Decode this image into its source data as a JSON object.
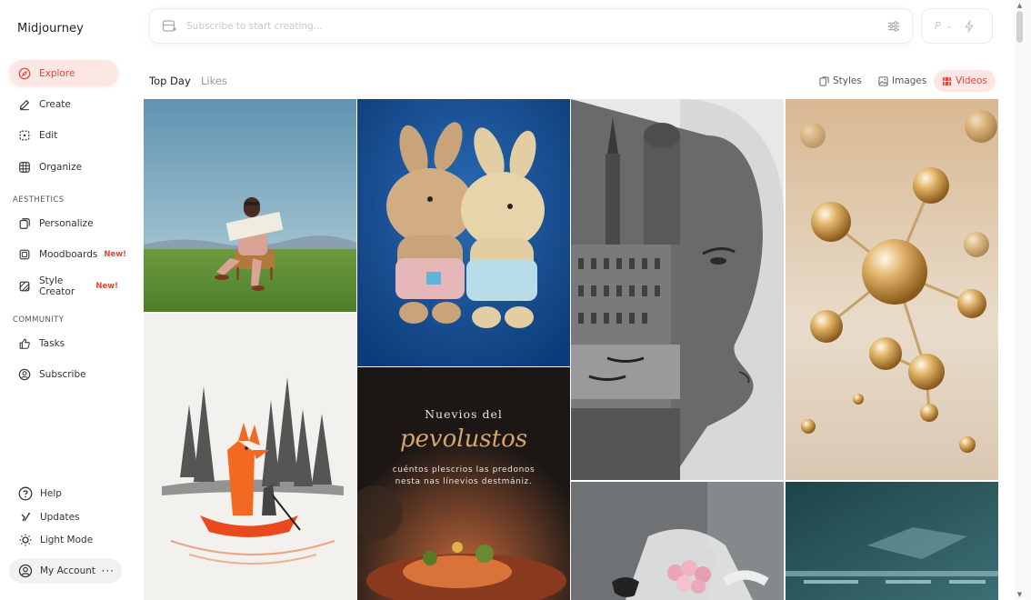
{
  "brand": "Midjourney",
  "nav": {
    "explore": "Explore",
    "create": "Create",
    "edit": "Edit",
    "organize": "Organize",
    "aesthetics_label": "AESTHETICS",
    "personalize": "Personalize",
    "moodboards": "Moodboards",
    "style_creator": "Style Creator",
    "new_badge": "New!",
    "community_label": "COMMUNITY",
    "tasks": "Tasks",
    "subscribe": "Subscribe"
  },
  "bottom": {
    "help": "Help",
    "updates": "Updates",
    "light_mode": "Light Mode",
    "account": "My Account",
    "account_more": "···"
  },
  "prompt": {
    "placeholder": "Subscribe to start creating...",
    "mode_letter": "P",
    "chevron": "⌄"
  },
  "tabs": {
    "top_day": "Top Day",
    "likes": "Likes"
  },
  "filters": {
    "styles": "Styles",
    "images": "Images",
    "videos": "Videos"
  },
  "poster": {
    "title": "Nuevios del",
    "script": "pevolustos",
    "line1": "cuéntos plescrios las predonos",
    "line2": "nesta nas línevios destmániz."
  },
  "colors": {
    "accent": "#e2473b",
    "accent_bg": "#fde7e4"
  }
}
